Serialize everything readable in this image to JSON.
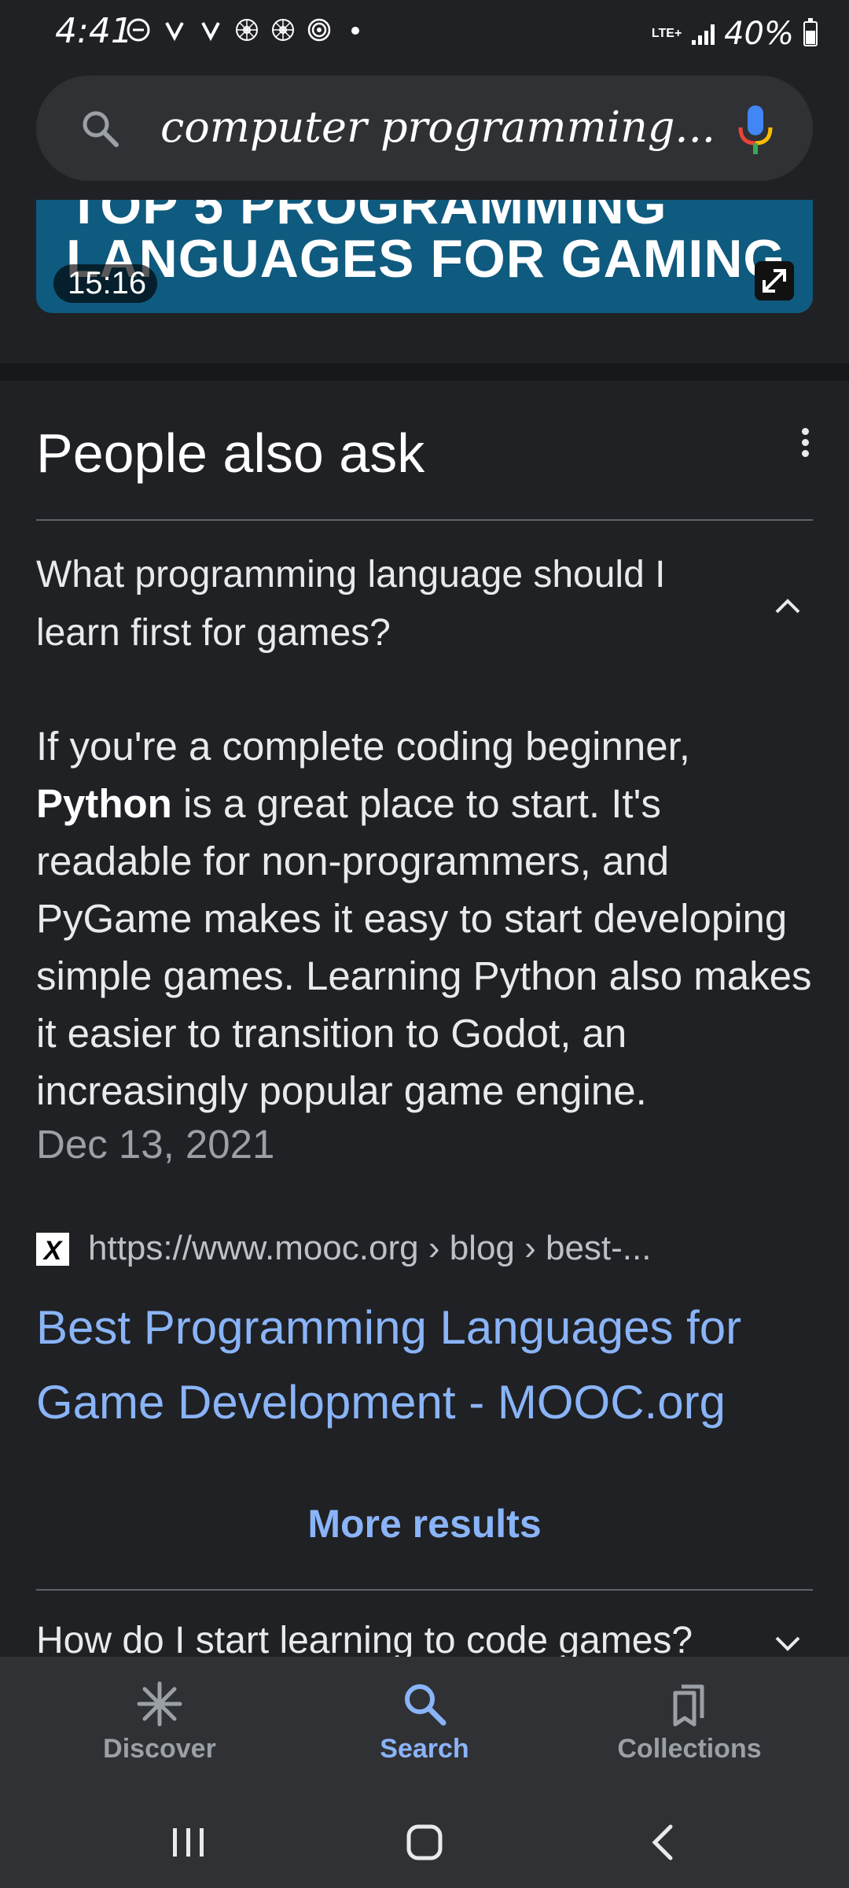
{
  "status_bar": {
    "time": "4:41",
    "network": "LTE+",
    "battery": "40%",
    "notification_icons": [
      "dnd-icon",
      "notif-u-icon",
      "notif-u-icon",
      "flower-icon",
      "flower-icon",
      "spiral-icon",
      "dot-icon"
    ]
  },
  "search": {
    "query": "computer programming..."
  },
  "video": {
    "line1": "TOP 5 PROGRAMMING",
    "line2": "LANGUAGES FOR GAMING",
    "duration": "15:16"
  },
  "people_also_ask": {
    "title": "People also ask",
    "question1": "What programming language should I learn first for games?",
    "answer_lead": "If you're a complete coding beginner,",
    "answer_bold": "Python",
    "answer_rest": "is a great place to start. It's readable for non-programmers, and PyGame makes it easy to start developing simple games. Learning Python also makes it easier to transition to Godot, an increasingly popular game engine.",
    "answer_date": "Dec 13, 2021",
    "source_favicon": "X",
    "source_url": "https://www.mooc.org › blog › best-...",
    "result_title": "Best Programming Languages for Game Development - MOOC.org",
    "more_results": "More results",
    "question2": "How do I start learning to code games?"
  },
  "bottom_nav": {
    "discover": "Discover",
    "search": "Search",
    "collections": "Collections"
  },
  "colors": {
    "background": "#202124",
    "link": "#8ab4f8",
    "surface": "#303134"
  }
}
